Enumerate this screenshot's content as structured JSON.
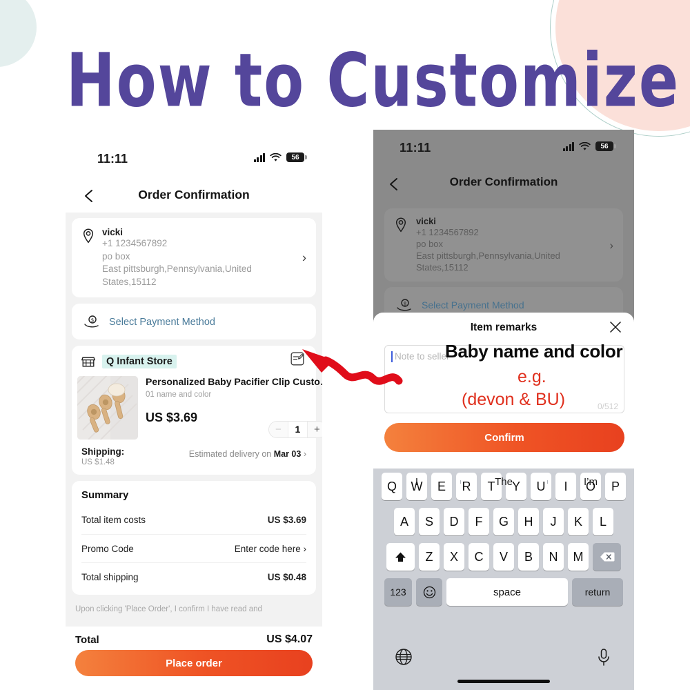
{
  "headline": "How to Customize",
  "colors": {
    "headline_purple": "#54469b",
    "accent_orange": "#ef5425",
    "annotation_red": "#e0301e",
    "highlight_mint": "#d8f2ee",
    "deco_pink": "#fbe0d9",
    "deco_mint": "#e4efee"
  },
  "status_bar": {
    "time": "11:11",
    "battery": "56",
    "signal_icon": "cellular-signal-icon",
    "wifi_icon": "wifi-icon"
  },
  "left_phone": {
    "nav": {
      "back_icon": "back-arrow-icon",
      "title": "Order Confirmation"
    },
    "address": {
      "pin_icon": "location-pin-icon",
      "name": "vicki",
      "phone": "+1 1234567892",
      "line1": "po box",
      "line2": "East pittsburgh,Pennsylvania,United",
      "line3": "States,15112",
      "chevron": "›"
    },
    "payment": {
      "icon": "payment-hand-coin-icon",
      "label": "Select Payment Method"
    },
    "store": {
      "icon": "storefront-icon",
      "name": "Q Infant Store",
      "edit_icon": "edit-note-icon"
    },
    "product": {
      "thumb_alt": "wooden-baby-brush-set-photo",
      "title": "Personalized Baby Pacifier Clip Custo…",
      "variant": "01 name and color",
      "price": "US $3.69",
      "qty_minus": "−",
      "qty_value": "1",
      "qty_plus": "+"
    },
    "shipping": {
      "label": "Shipping:",
      "cost": "US $1.48",
      "eta_prefix": "Estimated delivery on ",
      "eta_date": "Mar 03",
      "chevron": "›"
    },
    "summary": {
      "title": "Summary",
      "rows": [
        {
          "label": "Total item costs",
          "value": "US $3.69"
        },
        {
          "label": "Promo Code",
          "value": "Enter code here ›"
        },
        {
          "label": "Total shipping",
          "value": "US $0.48"
        }
      ]
    },
    "disclaimer": "Upon clicking 'Place Order', I confirm I have read and",
    "footer": {
      "total_label": "Total",
      "total_value": "US $4.07",
      "place_order_label": "Place order"
    }
  },
  "right_phone": {
    "nav": {
      "back_icon": "back-arrow-icon",
      "title": "Order Confirmation"
    },
    "address": {
      "pin_icon": "location-pin-icon",
      "name": "vicki",
      "phone": "+1 1234567892",
      "line1": "po box",
      "line2": "East pittsburgh,Pennsylvania,United",
      "line3": "States,15112",
      "chevron": "›"
    },
    "payment": {
      "icon": "payment-hand-coin-icon",
      "label": "Select Payment Method"
    },
    "modal": {
      "title": "Item remarks",
      "close_icon": "close-icon",
      "note_placeholder": "Note to seller",
      "note_value": "",
      "char_counter": "0/512",
      "confirm_label": "Confirm"
    },
    "keyboard": {
      "suggestions": [
        "I",
        "The",
        "I’m"
      ],
      "row1": [
        "Q",
        "W",
        "E",
        "R",
        "T",
        "Y",
        "U",
        "I",
        "O",
        "P"
      ],
      "row2": [
        "A",
        "S",
        "D",
        "F",
        "G",
        "H",
        "J",
        "K",
        "L"
      ],
      "row3": [
        "Z",
        "X",
        "C",
        "V",
        "B",
        "N",
        "M"
      ],
      "shift_icon": "shift-up-icon",
      "backspace_icon": "backspace-icon",
      "numbers_label": "123",
      "emoji_icon": "emoji-smiley-icon",
      "space_label": "space",
      "return_label": "return",
      "globe_icon": "globe-icon",
      "mic_icon": "microphone-icon"
    }
  },
  "annotations": {
    "arrow_icon": "red-squiggle-arrow-icon",
    "baby_name_text": "Baby name and color",
    "example_label": "e.g.",
    "example_value": "(devon & BU)"
  }
}
